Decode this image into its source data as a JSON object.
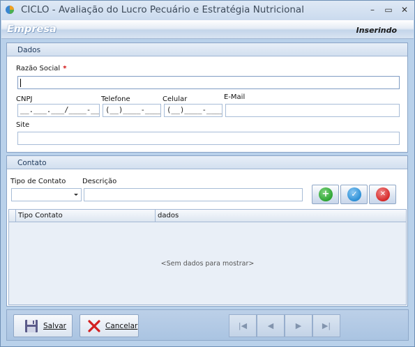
{
  "window": {
    "title": "CICLO - Avaliação do Lucro Pecuário e Estratégia Nutricional",
    "min_symbol": "–",
    "max_symbol": "▭",
    "close_symbol": "✕"
  },
  "header": {
    "title": "Empresa",
    "mode": "Inserindo"
  },
  "dados": {
    "group_title": "Dados",
    "razao_social_label": "Razão Social",
    "required_mark": "*",
    "razao_social_value": "",
    "cnpj_label": "CNPJ",
    "cnpj_mask": "__.___.___/____-__",
    "telefone_label": "Telefone",
    "telefone_mask": "(__)____-____",
    "celular_label": "Celular",
    "celular_mask": "(__)____-____",
    "email_label": "E-Mail",
    "email_value": "",
    "site_label": "Site",
    "site_value": ""
  },
  "contato": {
    "group_title": "Contato",
    "tipo_label": "Tipo de Contato",
    "tipo_value": "",
    "descricao_label": "Descrição",
    "descricao_value": "",
    "add_symbol": "+",
    "confirm_symbol": "✓",
    "remove_symbol": "✕",
    "grid": {
      "columns": [
        "Tipo Contato",
        "dados"
      ],
      "empty_text": "<Sem dados para mostrar>"
    }
  },
  "actions": {
    "save_label": "Salvar",
    "cancel_label": "Cancelar",
    "nav_first": "|◀",
    "nav_prev": "◀",
    "nav_next": "▶",
    "nav_last": "▶|"
  },
  "colors": {
    "window_bg": "#b9d1ea",
    "add_green": "#2ea533",
    "confirm_blue": "#2b8fd6",
    "remove_red": "#d62828",
    "required_red": "#d01010"
  }
}
